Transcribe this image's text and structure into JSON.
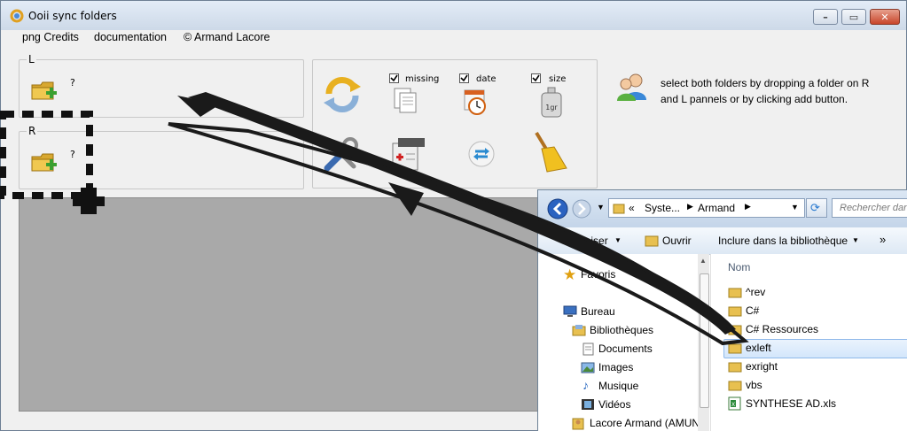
{
  "window": {
    "title": "Ooii sync folders"
  },
  "menu": [
    "png Credits",
    "documentation",
    "© Armand Lacore"
  ],
  "left_panel": {
    "label": "L",
    "value": "?"
  },
  "right_panel": {
    "label": "R",
    "value": "?"
  },
  "options": {
    "missing": "missing",
    "date": "date",
    "size": "size",
    "size_weight": "1gr"
  },
  "info_text": "select both folders by dropping a folder on R and L pannels or by clicking add button.",
  "explorer": {
    "breadcrumb": [
      "«",
      "Syste...",
      "Armand"
    ],
    "search_placeholder": "Rechercher dans",
    "toolbar": {
      "organize": "Organiser",
      "open": "Ouvrir",
      "include": "Inclure dans la bibliothèque",
      "more": "»"
    },
    "nav": {
      "favorites": "Favoris",
      "desktop": "Bureau",
      "libraries": "Bibliothèques",
      "documents": "Documents",
      "images": "Images",
      "music": "Musique",
      "videos": "Vidéos",
      "user": "Lacore Armand (AMUN"
    },
    "column_name": "Nom",
    "files": [
      "^rev",
      "C#",
      "C# Ressources",
      "exleft",
      "exright",
      "vbs",
      "SYNTHESE AD.xls"
    ],
    "selected": "exleft"
  },
  "colors": {
    "accent": "#3a7bd5",
    "arrow": "#1a1a1a",
    "gray_area": "#a9a9a9"
  }
}
